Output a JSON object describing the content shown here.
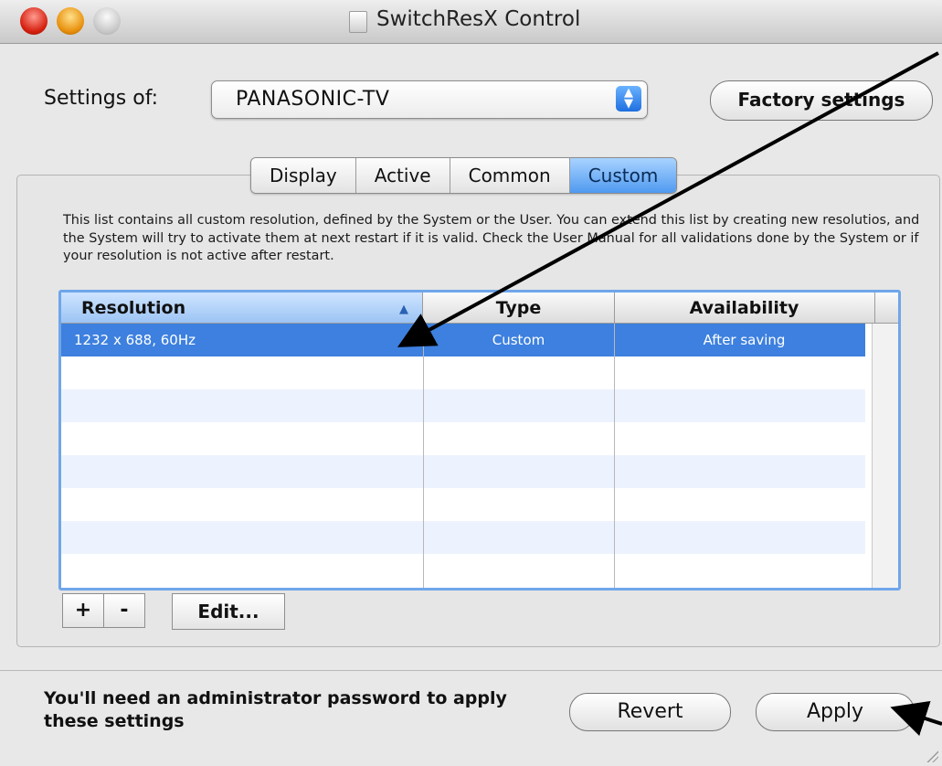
{
  "window": {
    "title": "SwitchResX Control"
  },
  "settings": {
    "label": "Settings of:",
    "selected_display": "PANASONIC-TV",
    "factory_button": "Factory settings"
  },
  "tabs": [
    {
      "label": "Display",
      "active": false
    },
    {
      "label": "Active",
      "active": false
    },
    {
      "label": "Common",
      "active": false
    },
    {
      "label": "Custom",
      "active": true
    }
  ],
  "custom": {
    "description": "This list contains all custom resolution, defined by the System or the User. You can extend this list by creating new resolutios, and the System will try to activate them at next restart if it is valid. Check the User Manual for all validations done by the System or if your resolution is not active after restart.",
    "table": {
      "columns": [
        "Resolution",
        "Type",
        "Availability"
      ],
      "sort_indicator": "▲",
      "rows": [
        {
          "resolution": "1232 x 688, 60Hz",
          "type": "Custom",
          "availability": "After saving",
          "selected": true
        }
      ]
    },
    "add_button": "+",
    "remove_button": "-",
    "edit_button": "Edit..."
  },
  "footer": {
    "admin_note": "You'll need an administrator password to apply these settings",
    "revert_button": "Revert",
    "apply_button": "Apply"
  },
  "colors": {
    "selection": "#3d80df",
    "annotation_arrow": "#000000"
  }
}
